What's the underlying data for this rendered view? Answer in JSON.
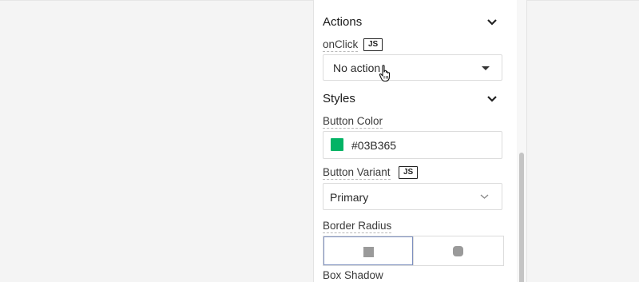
{
  "actions": {
    "title": "Actions",
    "onclick_label": "onClick",
    "onclick_badge": "JS",
    "onclick_value": "No action"
  },
  "styles": {
    "title": "Styles",
    "button_color_label": "Button Color",
    "button_color_value": "#03B365",
    "button_color_swatch": "#03B365",
    "button_variant_label": "Button Variant",
    "button_variant_badge": "JS",
    "button_variant_value": "Primary",
    "border_radius_label": "Border Radius",
    "border_radius_options": [
      "square-icon",
      "rounded-square-icon"
    ],
    "box_shadow_label": "Box Shadow"
  },
  "icons": {
    "collapse": "chevron-down-icon",
    "dropdown": "caret-down-icon",
    "cursor": "hand-pointer-cursor-icon"
  }
}
